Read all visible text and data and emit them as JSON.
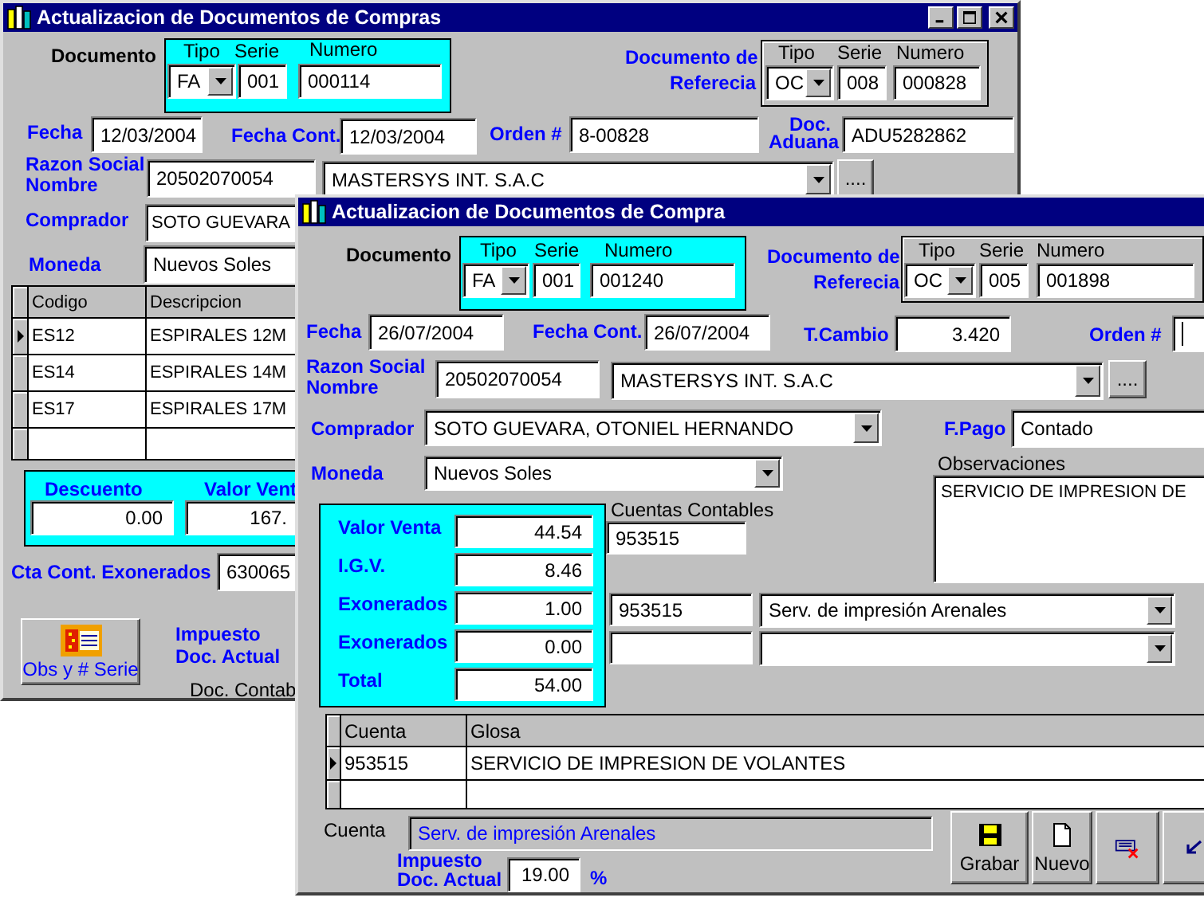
{
  "back_window": {
    "title": "Actualizacion de Documentos de Compras",
    "document": {
      "label": "Documento",
      "tipo_label": "Tipo",
      "serie_label": "Serie",
      "numero_label": "Numero",
      "tipo": "FA",
      "serie": "001",
      "numero": "000114"
    },
    "reference": {
      "label_1": "Documento de",
      "label_2": "Referecia",
      "tipo_label": "Tipo",
      "serie_label": "Serie",
      "numero_label": "Numero",
      "tipo": "OC",
      "serie": "008",
      "numero": "000828"
    },
    "fecha": {
      "label": "Fecha",
      "value": "12/03/2004"
    },
    "fecha_cont": {
      "label": "Fecha Cont.",
      "value": "12/03/2004"
    },
    "orden": {
      "label": "Orden #",
      "value": "8-00828"
    },
    "doc_aduana": {
      "label_1": "Doc.",
      "label_2": "Aduana",
      "value": "ADU5282862"
    },
    "razon_social": {
      "label_1": "Razon Social",
      "label_2": "Nombre",
      "ruc": "20502070054",
      "name": "MASTERSYS  INT.  S.A.C",
      "button": "...."
    },
    "comprador": {
      "label": "Comprador",
      "value": "SOTO GUEVARA"
    },
    "moneda": {
      "label": "Moneda",
      "value": "Nuevos Soles"
    },
    "grid": {
      "columns": [
        "Codigo",
        "Descripcion"
      ],
      "rows": [
        {
          "cells": [
            "ES12",
            "ESPIRALES 12M"
          ],
          "selected": true
        },
        {
          "cells": [
            "ES14",
            "ESPIRALES 14M"
          ],
          "selected": false
        },
        {
          "cells": [
            "ES17",
            "ESPIRALES  17M"
          ],
          "selected": false
        },
        {
          "cells": [],
          "selected": false
        }
      ]
    },
    "descuento": {
      "label": "Descuento",
      "value": "0.00"
    },
    "valor_venta": {
      "label": "Valor Vent",
      "value": "167."
    },
    "cta_exonerados": {
      "label": "Cta Cont. Exonerados",
      "value": "630065"
    },
    "obs_button": "Obs y # Serie",
    "impuesto": {
      "label_1": "Impuesto",
      "label_2": "Doc. Actual"
    },
    "doc_contab": "Doc. Contab"
  },
  "front_window": {
    "title": "Actualizacion de Documentos de Compra",
    "document": {
      "label": "Documento",
      "tipo_label": "Tipo",
      "serie_label": "Serie",
      "numero_label": "Numero",
      "tipo": "FA",
      "serie": "001",
      "numero": "001240"
    },
    "reference": {
      "label_1": "Documento de",
      "label_2": "Referecia",
      "tipo_label": "Tipo",
      "serie_label": "Serie",
      "numero_label": "Numero",
      "tipo": "OC",
      "serie": "005",
      "numero": "001898"
    },
    "fecha": {
      "label": "Fecha",
      "value": "26/07/2004"
    },
    "fecha_cont": {
      "label": "Fecha Cont.",
      "value": "26/07/2004"
    },
    "t_cambio": {
      "label": "T.Cambio",
      "value": "3.420"
    },
    "orden": {
      "label": "Orden #",
      "focused": true
    },
    "razon_social": {
      "label_1": "Razon Social",
      "label_2": "Nombre",
      "ruc": "20502070054",
      "name": "MASTERSYS  INT.  S.A.C",
      "button": "...."
    },
    "comprador": {
      "label": "Comprador",
      "value": "SOTO GUEVARA, OTONIEL HERNANDO"
    },
    "f_pago": {
      "label": "F.Pago",
      "value": "Contado"
    },
    "moneda": {
      "label": "Moneda",
      "value": "Nuevos Soles"
    },
    "observaciones": {
      "label": "Observaciones",
      "value": "SERVICIO DE IMPRESION DE"
    },
    "totals": [
      {
        "label": "Valor Venta",
        "value": "44.54"
      },
      {
        "label": "I.G.V.",
        "value": "8.46"
      },
      {
        "label": "Exonerados",
        "value": "1.00"
      },
      {
        "label": "Exonerados",
        "value": "0.00"
      },
      {
        "label": "Total",
        "value": "54.00"
      }
    ],
    "cuentas_contables": {
      "label": "Cuentas Contables",
      "value": "953515",
      "lines": [
        {
          "account": "953515",
          "description": "Serv. de impresión Arenales"
        }
      ]
    },
    "grid": {
      "columns": [
        "Cuenta",
        "Glosa"
      ],
      "rows": [
        {
          "cells": [
            "953515",
            "SERVICIO DE IMPRESION DE VOLANTES"
          ],
          "selected": true
        },
        {
          "cells": [],
          "selected": false
        }
      ]
    },
    "cuenta": {
      "label": "Cuenta",
      "value": "Serv. de impresión Arenales"
    },
    "impuesto": {
      "label_1": "Impuesto",
      "label_2": "Doc. Actual",
      "value": "19.00",
      "unit": "%"
    },
    "buttons": [
      {
        "kind": "save",
        "label": "Grabar"
      },
      {
        "kind": "new",
        "label": "Nuevo"
      },
      {
        "kind": "delete"
      },
      {
        "kind": "back"
      }
    ]
  }
}
